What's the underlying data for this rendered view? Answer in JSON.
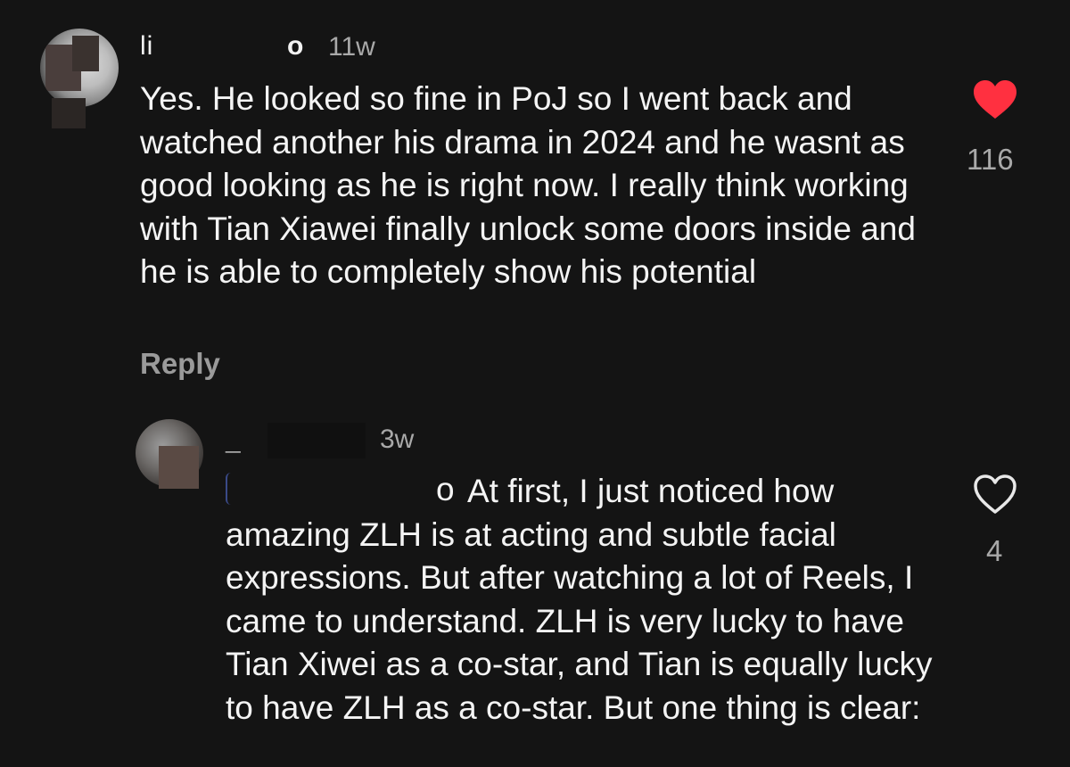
{
  "comments": [
    {
      "username_visible_start": "li",
      "username_visible_end": "o",
      "time": "11w",
      "text": "Yes. He looked so fine in PoJ so I went back and watched another his drama in 2024 and he wasnt as good looking as he is right now. I really think working with Tian Xiawei finally unlock some doors inside and he is able to completely show his potential",
      "reply_label": "Reply",
      "like_count": "116",
      "liked": true,
      "like_icon": "heart-filled-icon",
      "like_color": "#ff3040"
    },
    {
      "username_visible_start": "_",
      "time": "3w",
      "mention_visible_end": "o",
      "text": "At first, I just noticed how amazing ZLH is at acting and subtle facial expressions. But after watching a lot of Reels, I came to understand. ZLH is very lucky to have Tian Xiwei as a co-star, and Tian is equally lucky to have ZLH as a co-star. But one thing is clear:",
      "like_count": "4",
      "liked": false,
      "like_icon": "heart-outline-icon"
    }
  ],
  "colors": {
    "background": "#141414",
    "text": "#f4f4f4",
    "muted": "#a9a9a9"
  }
}
